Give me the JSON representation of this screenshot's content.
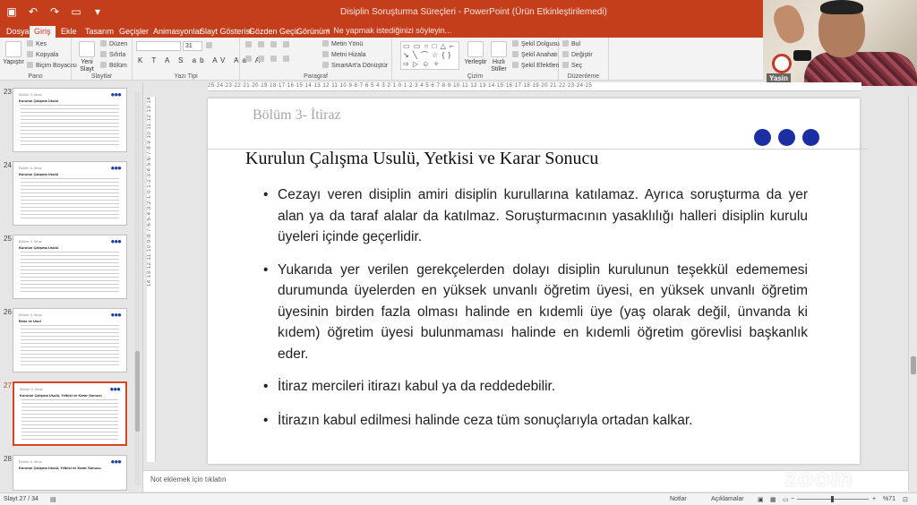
{
  "app": {
    "title": "Disiplin Soruşturma Süreçleri - PowerPoint (Ürün Etkinleştirilemedi)"
  },
  "qat": {
    "save_icon": "save-icon",
    "undo_icon": "undo-icon",
    "redo_icon": "redo-icon"
  },
  "tabs": [
    {
      "label": "Dosya"
    },
    {
      "label": "Giriş"
    },
    {
      "label": "Ekle"
    },
    {
      "label": "Tasarım"
    },
    {
      "label": "Geçişler"
    },
    {
      "label": "Animasyonlar"
    },
    {
      "label": "Slayt Gösterisi"
    },
    {
      "label": "Gözden Geçir"
    },
    {
      "label": "Görünüm"
    }
  ],
  "tell_me": "♀ Ne yapmak istediğinizi söyleyin...",
  "ribbon": {
    "clipboard": {
      "label": "Pano",
      "paste": "Yapıştır",
      "cut": "Kes",
      "copy": "Kopyala",
      "format_painter": "Biçim Boyacısı"
    },
    "slides": {
      "label": "Slaytlar",
      "new_slide": "Yeni Slayt",
      "layout": "Düzen",
      "reset": "Sıfırla",
      "section": "Bölüm"
    },
    "font": {
      "label": "Yazı Tipi",
      "font_size": "31",
      "format_row": "K T A S ab AV Aa A"
    },
    "paragraph": {
      "label": "Paragraf",
      "text_direction": "Metin Yönü",
      "align_text": "Metni Hizala",
      "smartart": "SmartArt'a Dönüştür"
    },
    "drawing": {
      "label": "Çizim",
      "arrange": "Yerleştir",
      "quick_styles": "Hızlı Stiller",
      "shape_fill": "Şekil Dolgusu",
      "shape_outline": "Şekil Anahatı",
      "shape_effects": "Şekil Efektleri",
      "shapes_gallery": "▭ ▭ ○ □ △ ⌐ ↘ ╲ ⌒ ☆ { } ⇨ ▷ ☺ ✧"
    },
    "editing": {
      "label": "Düzenleme",
      "find": "Bul",
      "replace": "Değiştir",
      "select": "Seç"
    }
  },
  "webcam": {
    "name": "Yasin"
  },
  "ruler": {
    "horizontal": "25·24·23·22·21·20·19·18·17·16·15·14·13·12·11·10·9·8·7·6·5·4·3·2·1·0·1·2·3·4·5·6·7·8·9·10·11·12·13·14·15·16·17·18·19·20·21·22·23·24·25",
    "vertical": "14·13·12·11·10·9·8·7·6·5·4·3·2·1·0·1·2·3·4·5·6·7·8·9·10·11·12·13·14"
  },
  "thumbnails": [
    {
      "num": "23",
      "title": "Bölüm 3- İtiraz",
      "heading": "Kurulun Çalışma Usulü"
    },
    {
      "num": "24",
      "title": "Bölüm 3- İtiraz",
      "heading": "Kurulun Çalışma Usulü"
    },
    {
      "num": "25",
      "title": "Bölüm 3- İtiraz",
      "heading": "Kurulun Çalışma Usulü"
    },
    {
      "num": "26",
      "title": "Bölüm 3- İtiraz",
      "heading": "İtiraz ve Usul"
    },
    {
      "num": "27",
      "title": "Bölüm 3- İtiraz",
      "heading": "Kurulun Çalışma Usulü, Yetkisi ve Karar Sonucu"
    },
    {
      "num": "28",
      "title": "Bölüm 3- İtiraz",
      "heading": "Kurulun Çalışma Usulü, Yetkisi ve Karar Sonucu"
    }
  ],
  "slide": {
    "section": "Bölüm 3- İtiraz",
    "heading": "Kurulun Çalışma Usulü, Yetkisi ve Karar Sonucu",
    "accent_color": "#1b2fa3",
    "bullets": [
      "Cezayı veren disiplin amiri disiplin kurullarına katılamaz. Ayrıca soruşturma da yer alan ya da taraf alalar da katılmaz. Soruşturmacının yasaklılığı halleri disiplin kurulu üyeleri içinde geçerlidir.",
      "Yukarıda yer verilen gerekçelerden dolayı disiplin kurulunun teşekkül edememesi durumunda üyelerden en yüksek unvanlı öğretim üyesi, en yüksek unvanlı öğretim üyesinin birden fazla olması halinde en kıdemli üye (yaş olarak değil, ünvanda ki kıdem) öğretim üyesi bulunmaması halinde en kıdemli öğretim görevlisi başkanlık eder.",
      "İtiraz mercileri itirazı kabul ya da reddedebilir.",
      "İtirazın kabul edilmesi halinde ceza tüm sonuçlarıyla ortadan kalkar."
    ]
  },
  "notes": {
    "placeholder": "Not eklemek için tıklatın"
  },
  "watermark": "zoom",
  "statusbar": {
    "slide_info": "Slayt 27 / 34",
    "notes": "Notlar",
    "comments": "Açıklamalar",
    "zoom": "%71"
  }
}
